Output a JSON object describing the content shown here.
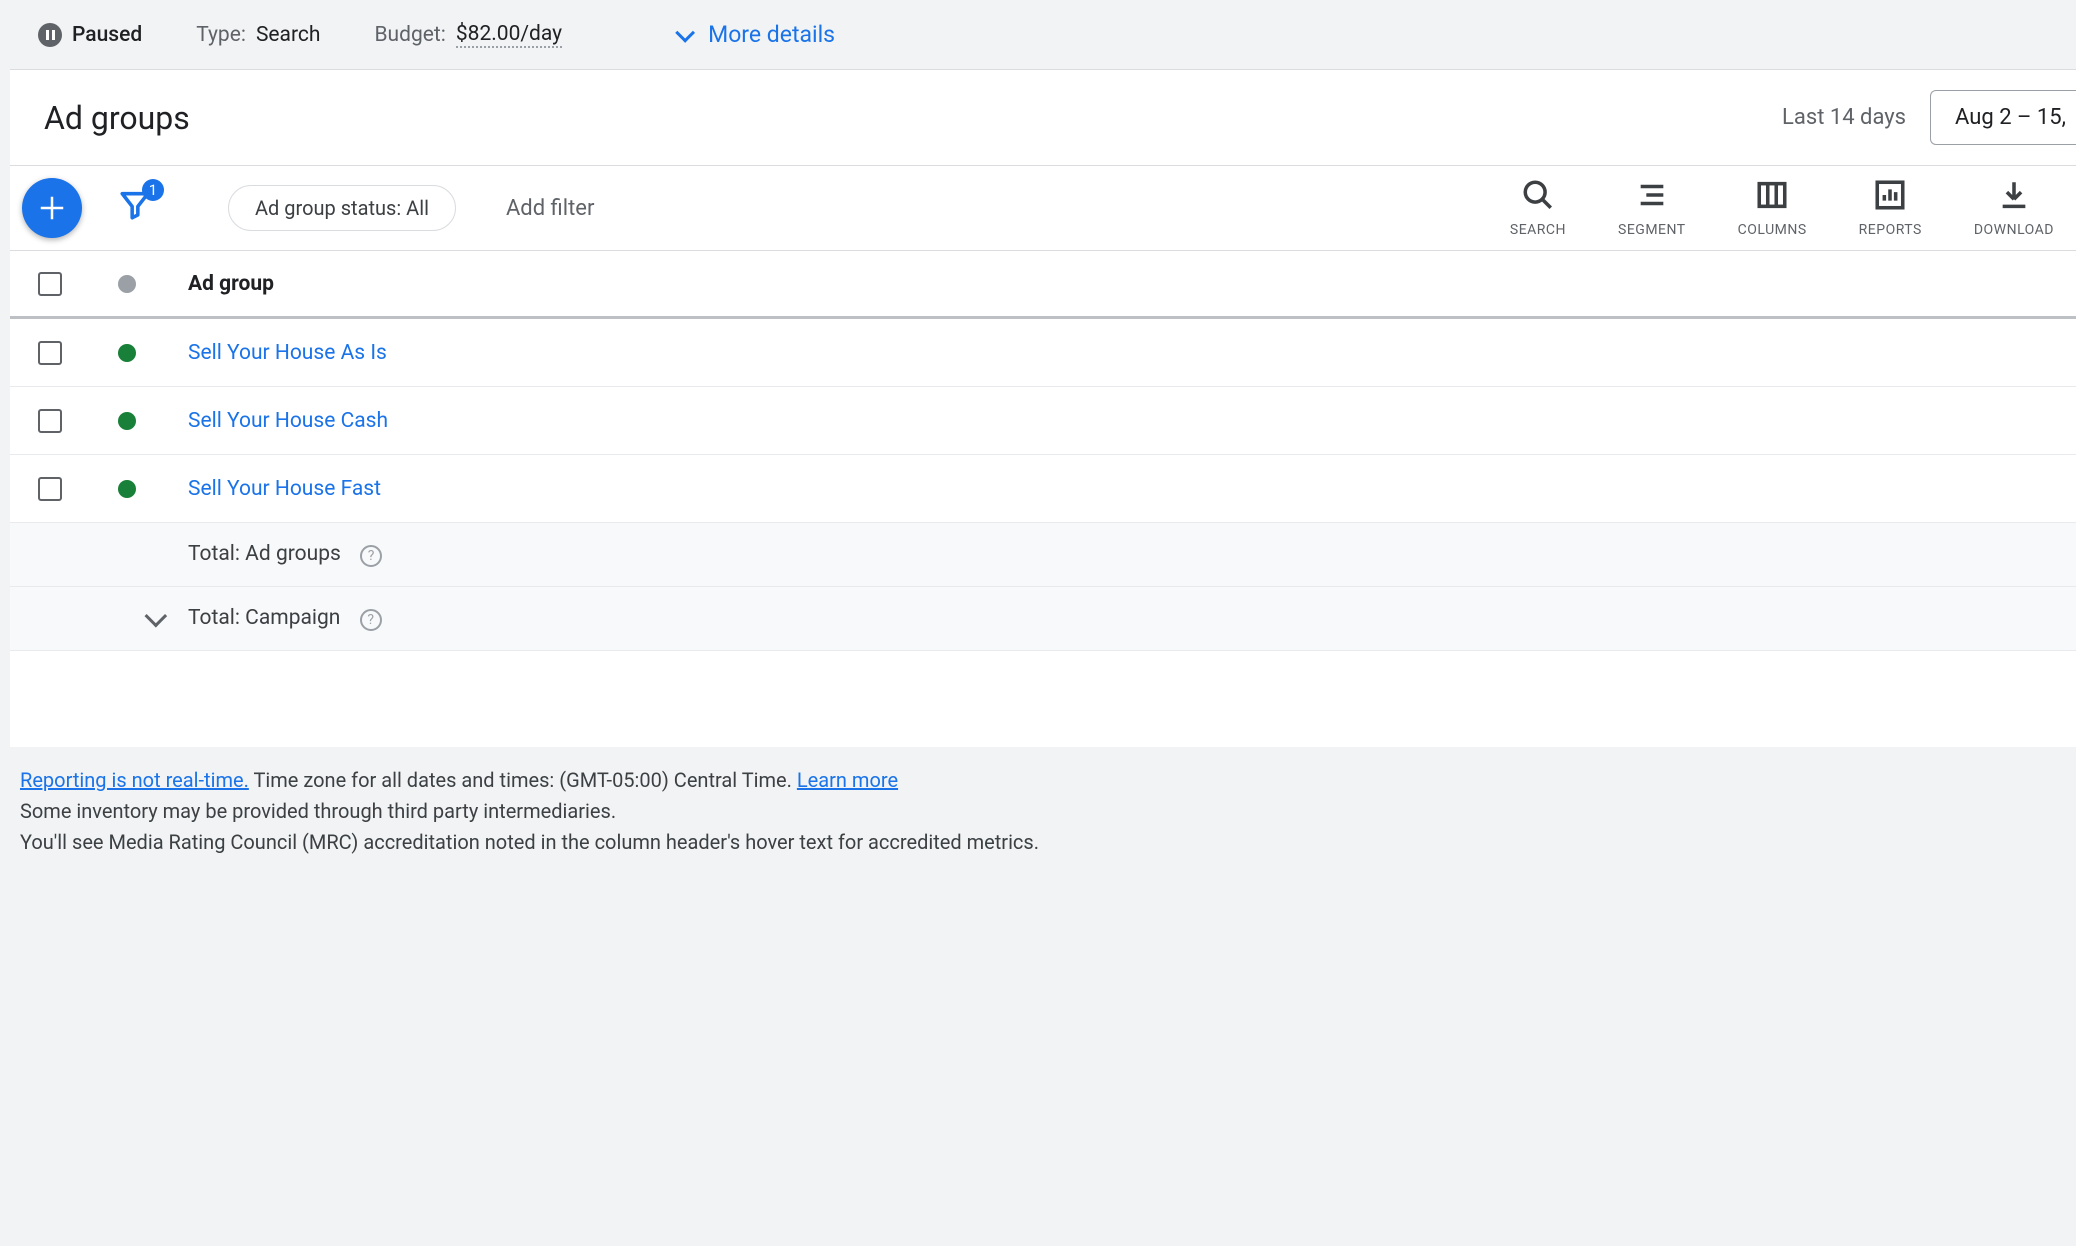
{
  "summary": {
    "status": "Paused",
    "type_label": "Type:",
    "type_value": "Search",
    "budget_label": "Budget:",
    "budget_value": "$82.00/day",
    "more_details": "More details"
  },
  "header": {
    "title": "Ad groups",
    "date_label": "Last 14 days",
    "date_range": "Aug 2 – 15,"
  },
  "toolbar": {
    "filter_count": "1",
    "chip": "Ad group status: All",
    "add_filter": "Add filter",
    "actions": [
      {
        "label": "SEARCH"
      },
      {
        "label": "SEGMENT"
      },
      {
        "label": "COLUMNS"
      },
      {
        "label": "REPORTS"
      },
      {
        "label": "DOWNLOAD"
      }
    ]
  },
  "table": {
    "header": "Ad group",
    "rows": [
      {
        "name": "Sell Your House As Is"
      },
      {
        "name": "Sell Your House Cash"
      },
      {
        "name": "Sell Your House Fast"
      }
    ],
    "total_groups": "Total: Ad groups",
    "total_campaign": "Total: Campaign"
  },
  "footnote": {
    "link1": "Reporting is not real-time.",
    "line1_rest": " Time zone for all dates and times: (GMT-05:00) Central Time. ",
    "link2": "Learn more",
    "line2": "Some inventory may be provided through third party intermediaries.",
    "line3": "You'll see Media Rating Council (MRC) accreditation noted in the column header's hover text for accredited metrics."
  }
}
